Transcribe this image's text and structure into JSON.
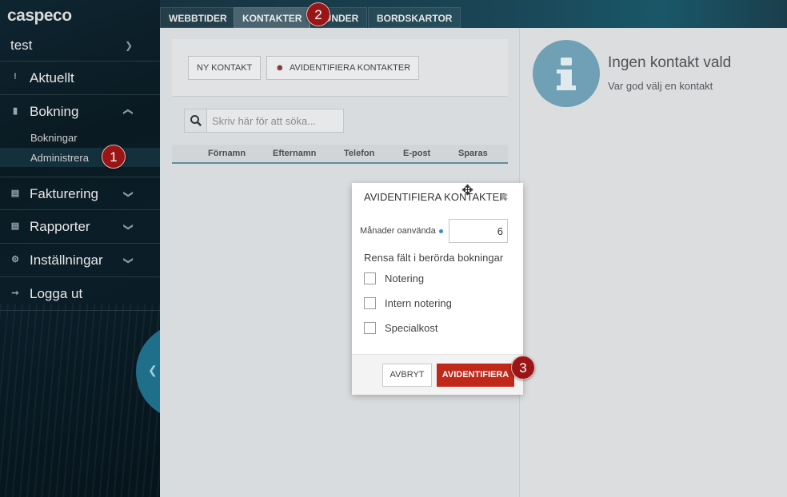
{
  "sidebar": {
    "logo": "caspeco",
    "user": "test",
    "items": [
      {
        "label": "Aktuellt",
        "icon": "exclamation-icon"
      },
      {
        "label": "Bokning",
        "icon": "book-icon",
        "expanded": true,
        "children": [
          {
            "label": "Bokningar"
          },
          {
            "label": "Administrera",
            "active": true
          }
        ]
      },
      {
        "label": "Fakturering",
        "icon": "bank-icon"
      },
      {
        "label": "Rapporter",
        "icon": "document-icon"
      },
      {
        "label": "Inställningar",
        "icon": "gear-icon"
      },
      {
        "label": "Logga ut",
        "icon": "sign-out-icon"
      }
    ]
  },
  "tabs": [
    {
      "label": "WEBBTIDER"
    },
    {
      "label": "KONTAKTER",
      "active": true
    },
    {
      "label": "KUNDER"
    },
    {
      "label": "BORDSKARTOR"
    }
  ],
  "toolbar": {
    "new_contact": "NY KONTAKT",
    "anonymize_contacts": "AVIDENTIFIERA KONTAKTER"
  },
  "search": {
    "placeholder": "Skriv här för att söka..."
  },
  "table": {
    "columns": [
      "Förnamn",
      "Efternamn",
      "Telefon",
      "E-post",
      "Sparas"
    ]
  },
  "detail": {
    "title": "Ingen kontakt vald",
    "subtitle": "Var god välj en kontakt"
  },
  "modal": {
    "title": "AVIDENTIFIERA KONTAKTER",
    "months_label": "Månader oanvända",
    "months_value": "6",
    "section_label": "Rensa fält i berörda bokningar",
    "checkboxes": [
      {
        "label": "Notering",
        "checked": false
      },
      {
        "label": "Intern notering",
        "checked": false
      },
      {
        "label": "Specialkost",
        "checked": false
      }
    ],
    "cancel": "AVBRYT",
    "confirm": "AVIDENTIFIERA"
  },
  "markers": [
    "1",
    "2",
    "3"
  ],
  "colors": {
    "accent_red": "#c0281a",
    "marker_red": "#9a1616",
    "info_blue": "#6fa0b5"
  }
}
